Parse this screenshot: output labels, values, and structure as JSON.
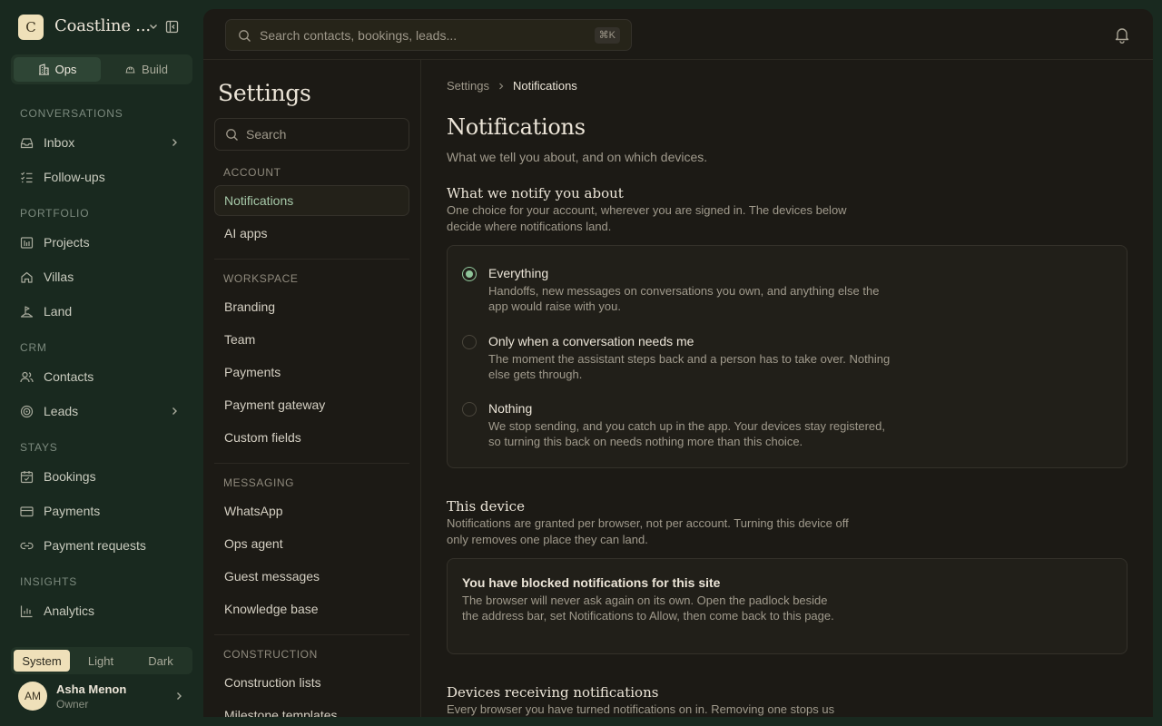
{
  "workspace": {
    "logo_letter": "C",
    "name": "Coastline ..."
  },
  "mode_switch": {
    "ops": "Ops",
    "build": "Build"
  },
  "nav": {
    "sections": [
      "CONVERSATIONS",
      "PORTFOLIO",
      "CRM",
      "STAYS",
      "INSIGHTS"
    ],
    "items": [
      {
        "label": "Inbox",
        "icon": "inbox-icon"
      },
      {
        "label": "Follow-ups",
        "icon": "list-check-icon"
      },
      {
        "label": "Projects",
        "icon": "chart-frame-icon"
      },
      {
        "label": "Villas",
        "icon": "home-icon"
      },
      {
        "label": "Land",
        "icon": "land-icon"
      },
      {
        "label": "Contacts",
        "icon": "users-icon"
      },
      {
        "label": "Leads",
        "icon": "target-icon"
      },
      {
        "label": "Bookings",
        "icon": "calendar-check-icon"
      },
      {
        "label": "Payments",
        "icon": "credit-card-icon"
      },
      {
        "label": "Payment requests",
        "icon": "link-icon"
      },
      {
        "label": "Analytics",
        "icon": "bar-chart-icon"
      }
    ]
  },
  "theme": {
    "system": "System",
    "light": "Light",
    "dark": "Dark",
    "selected": "System"
  },
  "user": {
    "initials": "AM",
    "name": "Asha Menon",
    "role": "Owner"
  },
  "topbar": {
    "search_placeholder": "Search contacts, bookings, leads...",
    "shortcut": "⌘K"
  },
  "settings": {
    "title": "Settings",
    "search_placeholder": "Search",
    "sections": {
      "account": "ACCOUNT",
      "workspace": "WORKSPACE",
      "messaging": "MESSAGING",
      "construction": "CONSTRUCTION"
    },
    "account_items": [
      "Notifications",
      "AI apps"
    ],
    "workspace_items": [
      "Branding",
      "Team",
      "Payments",
      "Payment gateway",
      "Custom fields"
    ],
    "messaging_items": [
      "WhatsApp",
      "Ops agent",
      "Guest messages",
      "Knowledge base"
    ],
    "construction_items": [
      "Construction lists",
      "Milestone templates"
    ]
  },
  "breadcrumb": {
    "root": "Settings",
    "current": "Notifications"
  },
  "page": {
    "title": "Notifications",
    "subtitle": "What we tell you about, and on which devices."
  },
  "notify_section": {
    "title": "What we notify you about",
    "desc": "One choice for your account, wherever you are signed in. The devices below decide where notifications land.",
    "options": [
      {
        "title": "Everything",
        "desc": "Handoffs, new messages on conversations you own, and anything else the app would raise with you."
      },
      {
        "title": "Only when a conversation needs me",
        "desc": "The moment the assistant steps back and a person has to take over. Nothing else gets through."
      },
      {
        "title": "Nothing",
        "desc": "We stop sending, and you catch up in the app. Your devices stay registered, so turning this back on needs nothing more than this choice."
      }
    ],
    "selected": "Everything"
  },
  "device_section": {
    "title": "This device",
    "desc": "Notifications are granted per browser, not per account. Turning this device off only removes one place they can land.",
    "blocked_title": "You have blocked notifications for this site",
    "blocked_desc": "The browser will never ask again on its own. Open the padlock beside the address bar, set Notifications to Allow, then come back to this page."
  },
  "devices_receiving": {
    "title": "Devices receiving notifications",
    "desc": "Every browser you have turned notifications on in. Removing one stops us"
  },
  "colors": {
    "accent": "#8fc59a",
    "sidebar_bg": "#19291f",
    "panel_bg": "#1c1a15",
    "cream": "#efe0b9"
  }
}
